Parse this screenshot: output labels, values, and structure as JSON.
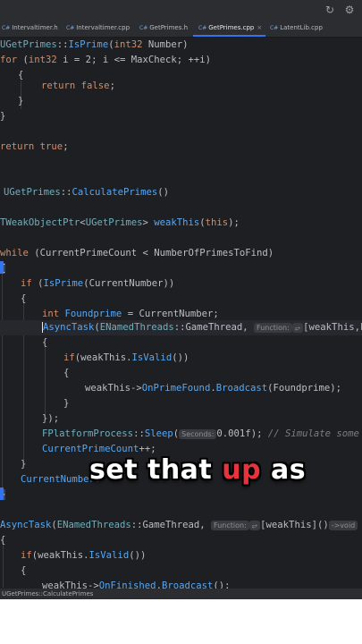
{
  "topbar": {
    "icons": [
      "refresh-icon",
      "settings-icon"
    ]
  },
  "tabs": [
    {
      "label": "Intervaltimer.h",
      "active": false
    },
    {
      "label": "Intervaltimer.cpp",
      "active": false
    },
    {
      "label": "GetPrimes.h",
      "active": false
    },
    {
      "label": "GetPrimes.cpp",
      "active": true
    },
    {
      "label": "LatentLib.cpp",
      "active": false
    }
  ],
  "tab_close": "×",
  "file_icon_glyph": "C#",
  "code": {
    "l1": [
      "UGetPrimes",
      "::",
      "IsPrime",
      "(",
      "int32",
      " Number)"
    ],
    "l2": [
      "for",
      " (",
      "int32",
      " i = 2; i <= MaxCheck; ++i)"
    ],
    "l3": "{",
    "l4": [
      "return",
      " ",
      "false",
      ";"
    ],
    "l5": "}",
    "l6": "}",
    "l7": [
      "return",
      " ",
      "true",
      ";"
    ],
    "l8": [
      "UGetPrimes",
      "::",
      "CalculatePrimes",
      "()"
    ],
    "l9": [
      "TWeakObjectPtr",
      "<",
      "UGetPrimes",
      "> ",
      "weakThis",
      "(",
      "this",
      ");"
    ],
    "l10": [
      "while",
      " (CurrentPrimeCount < NumberOfPrimesToFind)"
    ],
    "l11": "{",
    "l12": [
      "if",
      " (",
      "IsPrime",
      "(CurrentNumber))"
    ],
    "l13": "{",
    "l14": [
      "int",
      " ",
      "Foundprime",
      " = CurrentNumber;"
    ],
    "l15": [
      "AsyncTask",
      "(",
      "ENamedThreads",
      "::",
      "GameThread",
      ", "
    ],
    "l15_hint": "Function:",
    "l15_tail": "[weakThis,Fou",
    "l16": "{",
    "l17": [
      "if",
      "(weakThis.",
      "IsValid",
      "())"
    ],
    "l18": "{",
    "l19": [
      "weakThis->",
      "OnPrimeFound",
      ".",
      "Broadcast",
      "(Foundprime);"
    ],
    "l20": "}",
    "l21": "});",
    "l22": [
      "FPlatformProcess",
      "::",
      "Sleep",
      "("
    ],
    "l22_hint": "Seconds:",
    "l22_value": "0.001f);",
    "l22_comment": "// Simulate some de",
    "l23": [
      "CurrentPrimeCount",
      "++;"
    ],
    "l24": "}",
    "l25": [
      "CurrentNumber",
      "+"
    ],
    "l26": "}",
    "l27": [
      "AsyncTask",
      "(",
      "ENamedThreads",
      "::",
      "GameThread",
      ", "
    ],
    "l27_hint": "Function:",
    "l27_tail": "[weakThis]()",
    "l27_hint2": "->void",
    "l28": "{",
    "l29": [
      "if",
      "(weakThis.",
      "IsValid",
      "())"
    ],
    "l30": "{",
    "l31": [
      "weakThis->",
      "OnFinished",
      ".",
      "Broadcast",
      "();"
    ]
  },
  "statusbar": {
    "breadcrumb": "UGetPrimes::CalculatePrimes"
  },
  "caption": {
    "part1": "set that ",
    "highlight": "up",
    "part2": " as"
  }
}
